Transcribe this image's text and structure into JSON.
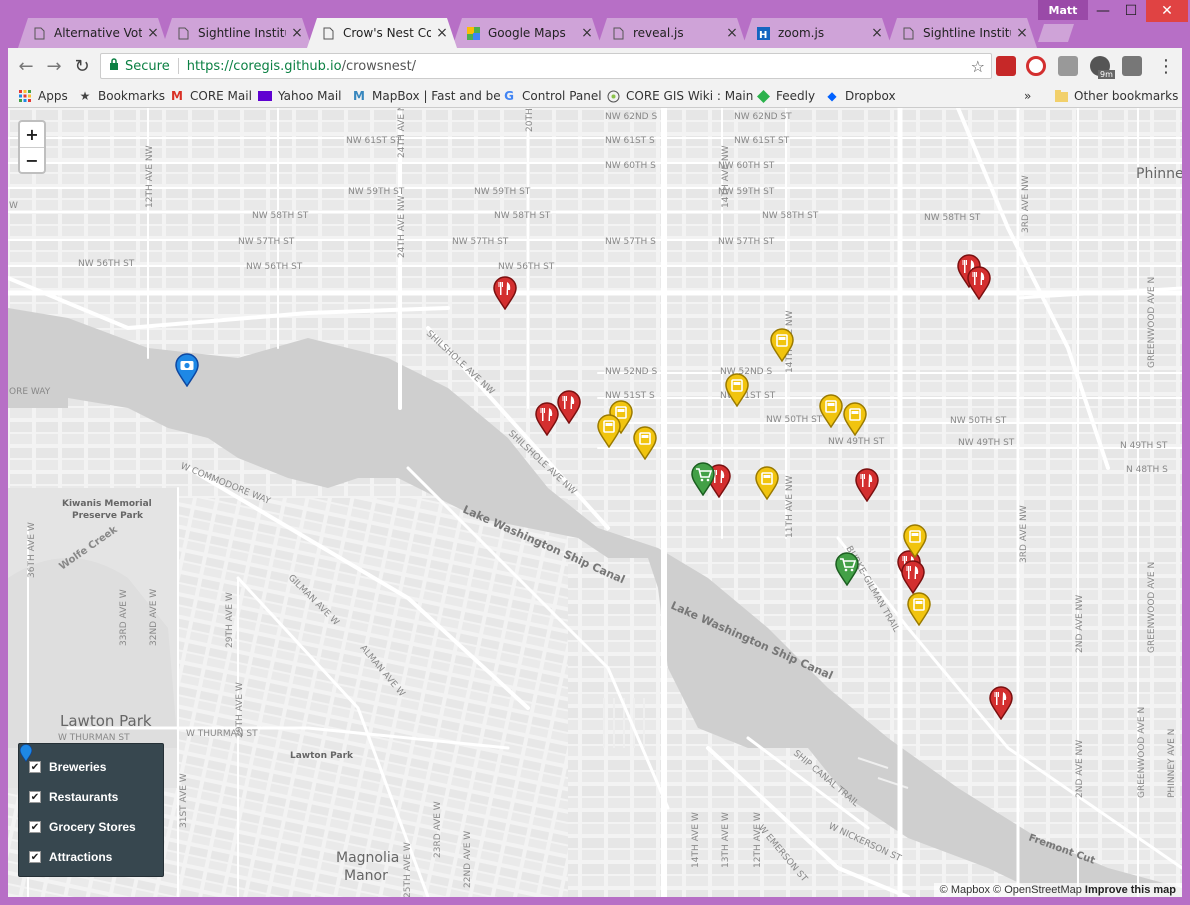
{
  "browser": {
    "profile_name": "Matt",
    "tabs": [
      {
        "title": "Alternative Voting",
        "icon": "page-icon",
        "active": false
      },
      {
        "title": "Sightline Institute",
        "icon": "page-icon",
        "active": false
      },
      {
        "title": "Crow's Nest Coffee",
        "icon": "page-icon",
        "active": true
      },
      {
        "title": "Google Maps",
        "icon": "google-maps-icon",
        "active": false
      },
      {
        "title": "reveal.js",
        "icon": "page-icon",
        "active": false
      },
      {
        "title": "zoom.js",
        "icon": "h-icon",
        "active": false
      },
      {
        "title": "Sightline Institute",
        "icon": "page-icon",
        "active": false
      }
    ],
    "secure_label": "Secure",
    "url_host": "https://coregis.github.io",
    "url_path": "/crowsnest/",
    "extension_badge": "9m",
    "bookmarks": [
      {
        "label": "Apps",
        "icon": "apps-grid-icon"
      },
      {
        "label": "Bookmarks",
        "icon": "star-icon"
      },
      {
        "label": "CORE Mail",
        "icon": "gmail-icon"
      },
      {
        "label": "Yahoo Mail",
        "icon": "yahoo-icon"
      },
      {
        "label": "MapBox | Fast and be",
        "icon": "mapbox-icon"
      },
      {
        "label": "Control Panel",
        "icon": "google-icon"
      },
      {
        "label": "CORE GIS Wiki : Main",
        "icon": "wiki-icon"
      },
      {
        "label": "Feedly",
        "icon": "feedly-icon"
      },
      {
        "label": "Dropbox",
        "icon": "dropbox-icon"
      }
    ],
    "overflow_label": "»",
    "other_bookmarks": "Other bookmarks"
  },
  "map": {
    "zoom_in": "+",
    "zoom_out": "−",
    "streets": {
      "nw62": "NW 62ND S",
      "nw62b": "NW 62ND ST",
      "nw61": "NW 61ST ST",
      "nw61b": "NW 61ST S",
      "nw61c": "NW 61ST ST",
      "nw60": "NW 60TH S",
      "nw60b": "NW 60TH ST",
      "nw59": "NW 59TH ST",
      "nw59b": "NW 59TH ST",
      "nw59c": "NW 59TH ST",
      "nw58": "NW 58TH ST",
      "nw58b": "NW 58TH ST",
      "nw58c": "NW 58TH ST",
      "nw58d": "NW 58TH ST",
      "nw57": "NW 57TH ST",
      "nw57b": "NW 57TH ST",
      "nw57c": "NW 57TH S",
      "nw57d": "NW 57TH ST",
      "nw56": "NW 56TH ST",
      "nw56b": "NW 56TH ST",
      "nw56c": "NW 56TH ST",
      "nw52": "NW 52ND S",
      "nw52b": "NW 52ND S",
      "nw51": "NW 51ST S",
      "nw51b": "NW 51ST ST",
      "nw50": "NW 50TH ST",
      "nw50b": "NW 50TH ST",
      "nw49": "NW 49TH ST",
      "nw49b": "NW 49TH ST",
      "n49": "N 49TH ST",
      "n48": "N 48TH S",
      "shilshole": "SHILSHOLE AVE NW",
      "shilshole2": "SHILSHOLE AVE NW",
      "commodore": "W COMMODORE WAY",
      "gilman": "GILMAN AVE W",
      "thurman": "W THURMAN ST",
      "thurman2": "W THURMAN ST",
      "burke": "BURKE-GILMAN TRAIL",
      "canal_trail": "SHIP CANAL TRAIL",
      "nickerson": "W NICKERSON ST",
      "emerson": "W EMERSON ST",
      "third_ave": "3RD AVE NW",
      "third_ave2": "3RD AVE NW",
      "second_ave": "2ND AVE NW",
      "second_ave2": "2ND AVE NW",
      "greenwood": "GREENWOOD AVE N",
      "greenwood2": "GREENWOOD AVE N",
      "greenwood3": "GREENWOOD AVE N",
      "phinney_ave": "PHINNEY AVE N",
      "twelfth": "12TH AVE NW",
      "eleventh": "11TH AVE NW",
      "fourteenth": "14TH AVE NW",
      "fourteenth_w": "14TH AVE W",
      "thirteenth_w": "13TH AVE W",
      "twelfth_w": "12TH AVE W",
      "twentieth": "20TH",
      "twentyfourth": "24TH AVE NW",
      "twentyfourth2": "24TH AVE NW",
      "twentyfourth3": "24TH",
      "thirtysecond": "32ND AVE NW",
      "thirtysecond_w": "32ND AVE W",
      "thirtythird": "33RD AVE W",
      "thirtysixth": "36TH AVE W",
      "thirtyfirst": "31ST AVE W",
      "twentyninth": "29TH AVE W",
      "twentyninth2": "29TH AVE W",
      "twentythird": "23RD AVE W",
      "twentysecond": "22ND AVE W",
      "twentyfifth": "25TH AVE W",
      "alman": "ALMAN AVE W",
      "fremont": "Fremont Cut",
      "ore_way": "ORE WAY",
      "w_edge": "W"
    },
    "places": {
      "lake1": "Lake Washington Ship Canal",
      "lake2": "Lake Washington Ship Canal",
      "kiwanis": "Kiwanis Memorial",
      "kiwanis2": "Preserve Park",
      "wolfe": "Wolfe Creek",
      "lawton": "Lawton Park",
      "lawton_small": "Lawton Park",
      "magnolia": "Magnolia",
      "manor": "Manor",
      "phinney": "Phinney"
    },
    "legend": [
      {
        "label": "Breweries",
        "color": "#f1c40f",
        "checked": "✔"
      },
      {
        "label": "Restaurants",
        "color": "#d32f2f",
        "checked": "✔"
      },
      {
        "label": "Grocery Stores",
        "color": "#43a047",
        "checked": "✔"
      },
      {
        "label": "Attractions",
        "color": "#1e88e5",
        "checked": "✔"
      }
    ],
    "attribution": {
      "mapbox": "© Mapbox",
      "osm": "© OpenStreetMap",
      "improve": "Improve this map"
    }
  }
}
